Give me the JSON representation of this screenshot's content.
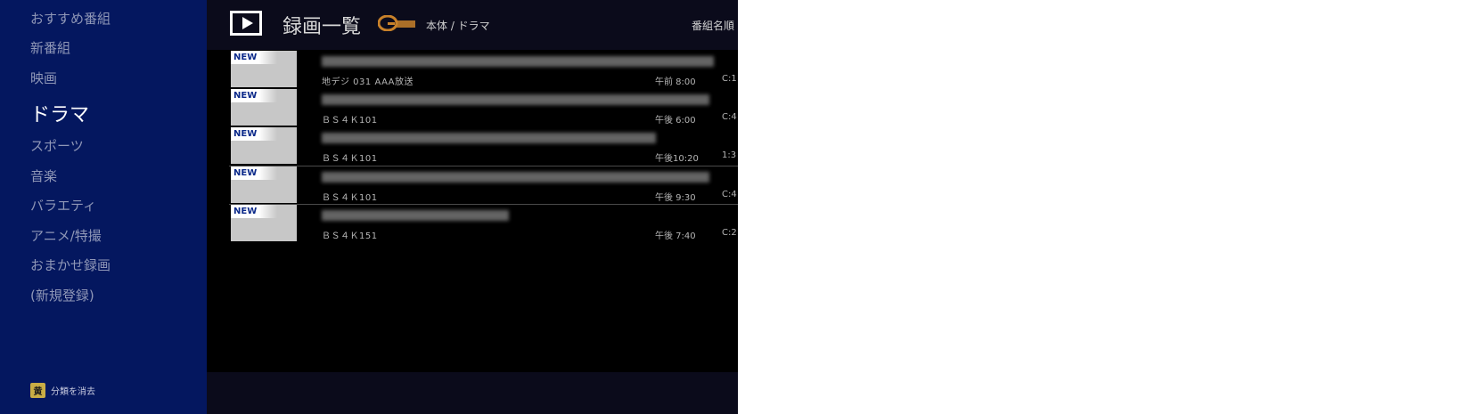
{
  "sidebar": {
    "items": [
      {
        "label": "おすすめ番組"
      },
      {
        "label": "新番組"
      },
      {
        "label": "映画"
      },
      {
        "label": "ドラマ"
      },
      {
        "label": "スポーツ"
      },
      {
        "label": "音楽"
      },
      {
        "label": "バラエティ"
      },
      {
        "label": "アニメ/特撮"
      },
      {
        "label": "おまかせ録画"
      },
      {
        "label": "(新規登録)"
      }
    ],
    "active_index": 3,
    "footer": {
      "key_icon": "黄",
      "label": "分類を消去"
    }
  },
  "header": {
    "icon": "play-icon",
    "title": "録画一覧",
    "logo": "G-GUIDE",
    "breadcrumb": "本体 / ドラマ",
    "sort": "番組名順"
  },
  "recordings": [
    {
      "badge": "NEW",
      "channel": "地デジ 031  AAA放送",
      "time": "午前 8:00",
      "duration": "C:1"
    },
    {
      "badge": "NEW",
      "channel": "ＢＳ４Ｋ101",
      "time": "午後 6:00",
      "duration": "C:4"
    },
    {
      "badge": "NEW",
      "channel": "ＢＳ４Ｋ101",
      "time": "午後10:20",
      "duration": "1:3"
    },
    {
      "badge": "NEW",
      "channel": "ＢＳ４Ｋ101",
      "time": "午後 9:30",
      "duration": "C:4"
    },
    {
      "badge": "NEW",
      "channel": "ＢＳ４Ｋ151",
      "time": "午後 7:40",
      "duration": "C:2"
    }
  ],
  "colors": {
    "sidebar_bg": "#04175f",
    "badge_text": "#0c2a8a",
    "logo_orange": "#c8812a"
  }
}
